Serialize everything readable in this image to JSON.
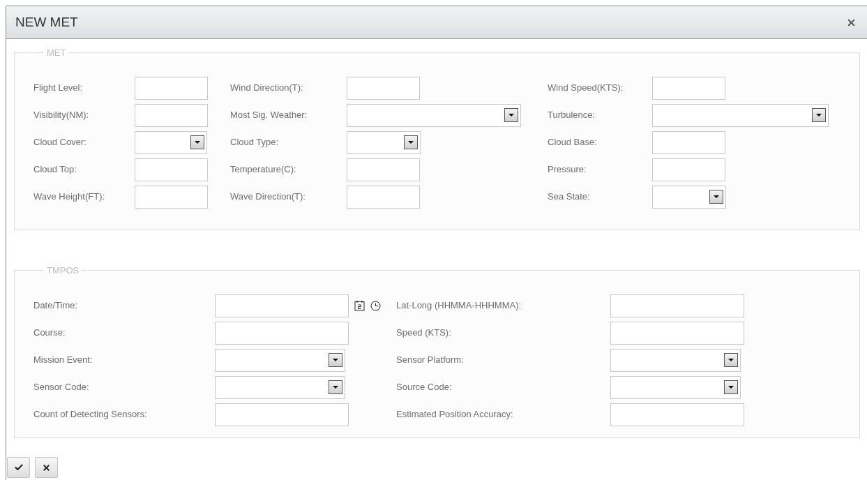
{
  "window": {
    "title": "NEW MET"
  },
  "sections": [
    {
      "legend": "MET",
      "rows": [
        [
          {
            "label": "Flight Level:",
            "kind": "text"
          },
          {
            "label": "Wind Direction(T):",
            "kind": "text"
          },
          {
            "label": "Wind Speed(KTS):",
            "kind": "text"
          }
        ],
        [
          {
            "label": "Visibility(NM):",
            "kind": "text"
          },
          {
            "label": "Most Sig. Weather:",
            "kind": "select-wide"
          },
          {
            "label": "Turbulence:",
            "kind": "select-wide"
          }
        ],
        [
          {
            "label": "Cloud Cover:",
            "kind": "select"
          },
          {
            "label": "Cloud Type:",
            "kind": "select"
          },
          {
            "label": "Cloud Base:",
            "kind": "text"
          }
        ],
        [
          {
            "label": "Cloud Top:",
            "kind": "text"
          },
          {
            "label": "Temperature(C):",
            "kind": "text"
          },
          {
            "label": "Pressure:",
            "kind": "text"
          }
        ],
        [
          {
            "label": "Wave Height(FT):",
            "kind": "text"
          },
          {
            "label": "Wave Direction(T):",
            "kind": "text"
          },
          {
            "label": "Sea State:",
            "kind": "select"
          }
        ]
      ]
    },
    {
      "legend": "TMPOS",
      "rows": [
        [
          {
            "label": "Date/Time:",
            "kind": "datetime"
          },
          {
            "label": "Lat-Long (HHMMA-HHHMMA):",
            "kind": "text"
          }
        ],
        [
          {
            "label": "Course:",
            "kind": "text"
          },
          {
            "label": "Speed (KTS):",
            "kind": "text"
          }
        ],
        [
          {
            "label": "Mission Event:",
            "kind": "select"
          },
          {
            "label": "Sensor Platform:",
            "kind": "select"
          }
        ],
        [
          {
            "label": "Sensor Code:",
            "kind": "select"
          },
          {
            "label": "Source Code:",
            "kind": "select"
          }
        ],
        [
          {
            "label": "Count of Detecting Sensors:",
            "kind": "text"
          },
          {
            "label": "Estimated Position Accuracy:",
            "kind": "text"
          }
        ]
      ]
    }
  ]
}
